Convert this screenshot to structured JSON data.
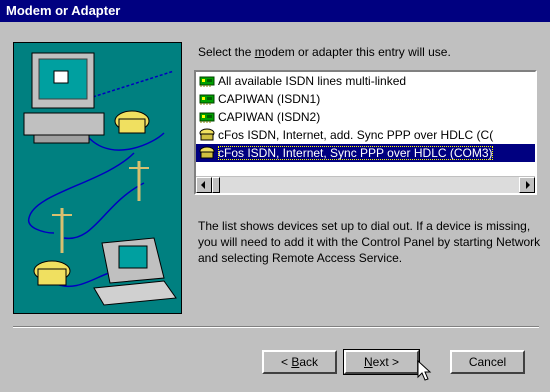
{
  "window": {
    "title": "Modem or Adapter"
  },
  "prompt": {
    "before": "Select the ",
    "accel": "m",
    "after": "odem or adapter this entry will use."
  },
  "devices": [
    {
      "label": "All available ISDN lines multi-linked",
      "icon": "isdn-card-icon"
    },
    {
      "label": "CAPIWAN (ISDN1)",
      "icon": "isdn-card-icon"
    },
    {
      "label": "CAPIWAN (ISDN2)",
      "icon": "isdn-card-icon"
    },
    {
      "label": "cFos ISDN, Internet, add. Sync PPP over HDLC (C(",
      "icon": "modem-icon"
    },
    {
      "label": "cFos ISDN, Internet, Sync PPP over HDLC (COM3)",
      "icon": "modem-icon",
      "selected": true
    }
  ],
  "info_text": "The list shows devices set up to dial out.  If a device is missing, you will need to add it with the Control Panel by starting Network and selecting Remote Access Service.",
  "buttons": {
    "back": {
      "prefix": "< ",
      "accel": "B",
      "rest": "ack"
    },
    "next": {
      "accel": "N",
      "rest": "ext >"
    },
    "cancel": {
      "label": "Cancel"
    }
  },
  "colors": {
    "titlebar": "#000080",
    "face": "#c0c0c0",
    "illustration_bg": "#008080",
    "selection": "#000080"
  }
}
